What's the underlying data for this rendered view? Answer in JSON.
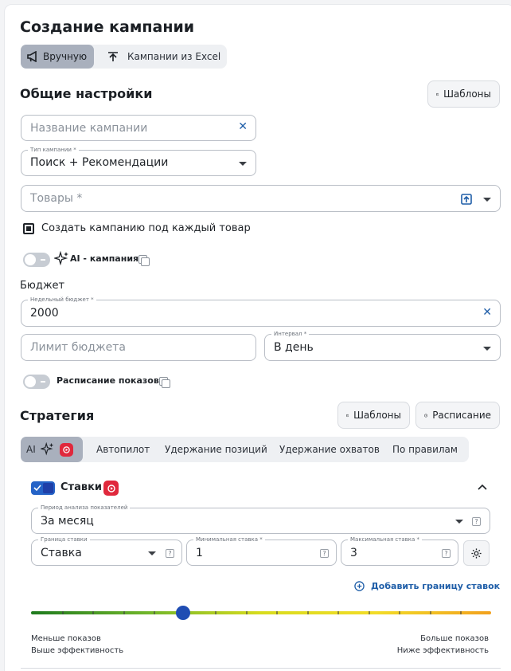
{
  "page": {
    "title": "Создание кампании"
  },
  "mode_tabs": {
    "manual": "Вручную",
    "excel": "Кампании из Excel"
  },
  "general": {
    "title": "Общие настройки",
    "templates_button": "Шаблоны",
    "campaign_name": {
      "placeholder": "Название кампании",
      "value": ""
    },
    "campaign_type": {
      "label": "Тип кампании *",
      "value": "Поиск + Рекомендации"
    },
    "products": {
      "placeholder": "Товары *"
    },
    "per_product_checkbox": {
      "label": "Создать кампанию под каждый товар",
      "checked": true
    },
    "ai_campaign": {
      "label": "AI - кампания",
      "enabled": false
    }
  },
  "budget": {
    "title": "Бюджет",
    "weekly": {
      "label": "Недельный бюджет *",
      "value": "2000"
    },
    "limit": {
      "placeholder": "Лимит бюджета"
    },
    "interval": {
      "label": "Интервал *",
      "value": "В день"
    },
    "schedule_toggle": {
      "label": "Расписание показов",
      "enabled": false
    }
  },
  "strategy": {
    "title": "Стратегия",
    "templates_button": "Шаблоны",
    "schedule_button": "Расписание",
    "tabs": [
      "AI",
      "Автопилот",
      "Удержание позиций",
      "Удержание охватов",
      "По правилам"
    ],
    "active_tab": "AI"
  },
  "bids": {
    "title": "Ставки",
    "enabled": true,
    "period": {
      "label": "Период анализа показателей",
      "value": "За месяц"
    },
    "bound": {
      "label": "Граница ставки",
      "value": "Ставка"
    },
    "min_bid": {
      "label": "Минимальная ставка *",
      "value": "1"
    },
    "max_bid": {
      "label": "Максимальная ставка *",
      "value": "3"
    },
    "add_bound": "Добавить границу ставок",
    "slider": {
      "value": 0.33,
      "left_top": "Меньше показов",
      "left_bottom": "Выше эффективность",
      "right_top": "Больше показов",
      "right_bottom": "Ниже эффективность"
    }
  },
  "colors": {
    "accent": "#1f5ea8",
    "active_tab": "#a9b0bd",
    "checkbox": "#2563c7",
    "knob": "#1f4db3",
    "brand_red": "#e0283c"
  }
}
